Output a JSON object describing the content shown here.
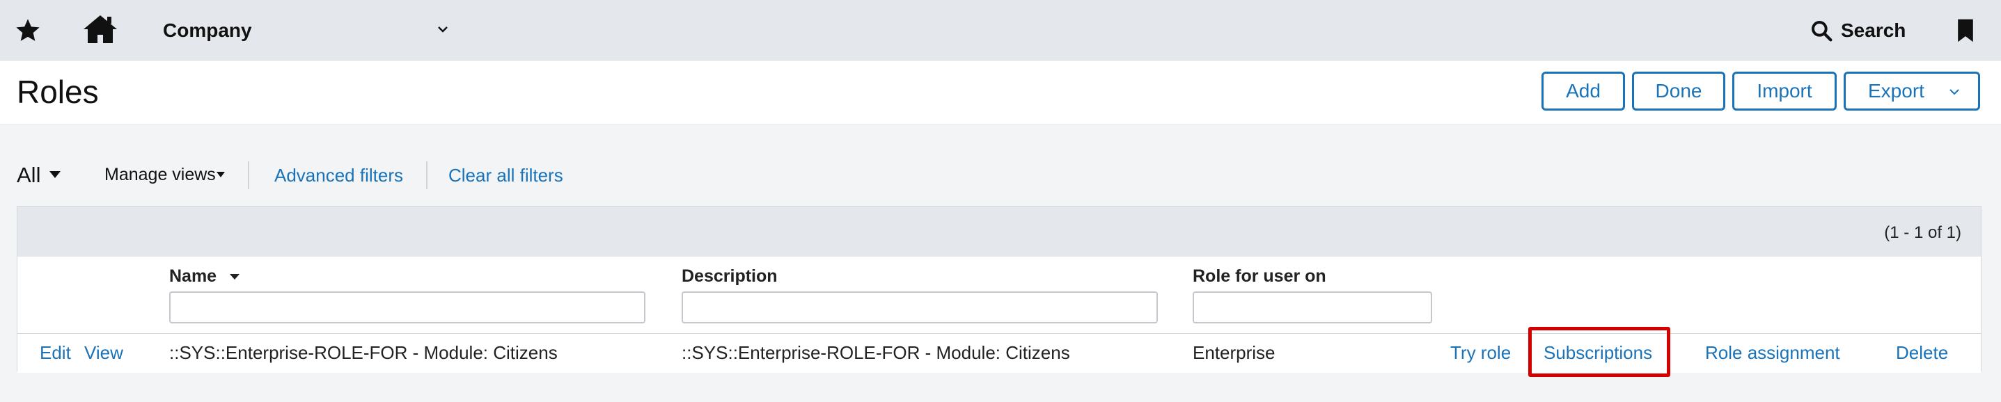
{
  "topbar": {
    "company_label": "Company",
    "search_label": "Search",
    "icons": [
      "star-icon",
      "home-icon",
      "chevron-down-icon",
      "search-icon",
      "bookmark-icon"
    ]
  },
  "header": {
    "title": "Roles",
    "buttons": {
      "add": "Add",
      "done": "Done",
      "import": "Import",
      "export": "Export"
    }
  },
  "filters": {
    "view": "All",
    "manage_views": "Manage views",
    "advanced": "Advanced filters",
    "clear": "Clear all filters"
  },
  "table": {
    "count": "(1 - 1 of 1)",
    "columns": {
      "name": "Name",
      "description": "Description",
      "role_for": "Role for user on"
    },
    "rows": [
      {
        "edit": "Edit",
        "view": "View",
        "name": "::SYS::Enterprise-ROLE-FOR - Module: Citizens",
        "description": "::SYS::Enterprise-ROLE-FOR - Module: Citizens",
        "role_for": "Enterprise",
        "try_role": "Try role",
        "subscriptions": "Subscriptions",
        "role_assignment": "Role assignment",
        "delete": "Delete"
      }
    ]
  },
  "colors": {
    "accent": "#1a73b8",
    "highlight": "#d40000",
    "topbar_bg": "#e4e8ec"
  }
}
